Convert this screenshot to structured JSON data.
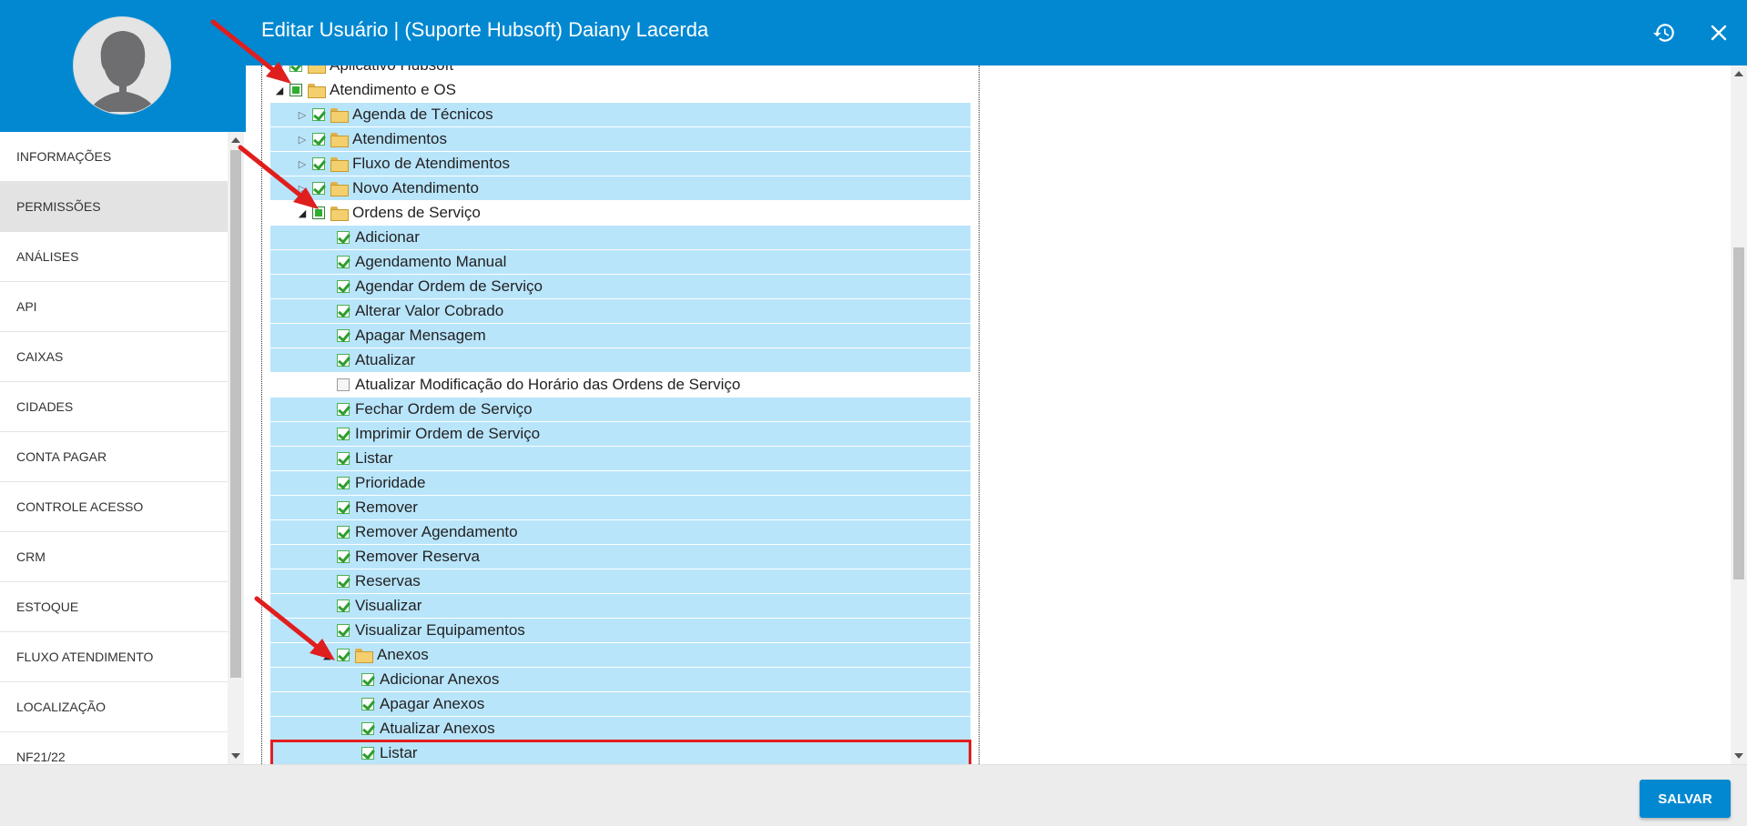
{
  "header": {
    "title": "Editar Usuário | (Suporte Hubsoft) Daiany Lacerda",
    "history_icon": "history-icon",
    "close_icon": "close-icon"
  },
  "sidebar": {
    "items": [
      {
        "label": "INFORMAÇÕES",
        "active": false
      },
      {
        "label": "PERMISSÕES",
        "active": true
      },
      {
        "label": "ANÁLISES",
        "active": false
      },
      {
        "label": "API",
        "active": false
      },
      {
        "label": "CAIXAS",
        "active": false
      },
      {
        "label": "CIDADES",
        "active": false
      },
      {
        "label": "CONTA PAGAR",
        "active": false
      },
      {
        "label": "CONTROLE ACESSO",
        "active": false
      },
      {
        "label": "CRM",
        "active": false
      },
      {
        "label": "ESTOQUE",
        "active": false
      },
      {
        "label": "FLUXO ATENDIMENTO",
        "active": false
      },
      {
        "label": "LOCALIZAÇÃO",
        "active": false
      },
      {
        "label": "NF21/22",
        "active": false
      }
    ]
  },
  "tree": {
    "rows": [
      {
        "label": "Aplicativo Hubsoft",
        "level": 1,
        "expander": "closed",
        "check": "checked",
        "folder": true,
        "selected": false
      },
      {
        "label": "Atendimento e OS",
        "level": 1,
        "expander": "open",
        "check": "partial",
        "folder": true,
        "selected": false
      },
      {
        "label": "Agenda de Técnicos",
        "level": 2,
        "expander": "closed",
        "check": "checked",
        "folder": true,
        "selected": true
      },
      {
        "label": "Atendimentos",
        "level": 2,
        "expander": "closed",
        "check": "checked",
        "folder": true,
        "selected": true
      },
      {
        "label": "Fluxo de Atendimentos",
        "level": 2,
        "expander": "closed",
        "check": "checked",
        "folder": true,
        "selected": true
      },
      {
        "label": "Novo Atendimento",
        "level": 2,
        "expander": "closed",
        "check": "checked",
        "folder": true,
        "selected": true
      },
      {
        "label": "Ordens de Serviço",
        "level": 2,
        "expander": "open",
        "check": "partial",
        "folder": true,
        "selected": false
      },
      {
        "label": "Adicionar",
        "level": 3,
        "expander": "none",
        "check": "checked",
        "folder": false,
        "selected": true
      },
      {
        "label": "Agendamento Manual",
        "level": 3,
        "expander": "none",
        "check": "checked",
        "folder": false,
        "selected": true
      },
      {
        "label": "Agendar Ordem de Serviço",
        "level": 3,
        "expander": "none",
        "check": "checked",
        "folder": false,
        "selected": true
      },
      {
        "label": "Alterar Valor Cobrado",
        "level": 3,
        "expander": "none",
        "check": "checked",
        "folder": false,
        "selected": true
      },
      {
        "label": "Apagar Mensagem",
        "level": 3,
        "expander": "none",
        "check": "checked",
        "folder": false,
        "selected": true
      },
      {
        "label": "Atualizar",
        "level": 3,
        "expander": "none",
        "check": "checked",
        "folder": false,
        "selected": true
      },
      {
        "label": "Atualizar Modificação do Horário das Ordens de Serviço",
        "level": 3,
        "expander": "none",
        "check": "unchecked",
        "folder": false,
        "selected": false
      },
      {
        "label": "Fechar Ordem de Serviço",
        "level": 3,
        "expander": "none",
        "check": "checked",
        "folder": false,
        "selected": true
      },
      {
        "label": "Imprimir Ordem de Serviço",
        "level": 3,
        "expander": "none",
        "check": "checked",
        "folder": false,
        "selected": true
      },
      {
        "label": "Listar",
        "level": 3,
        "expander": "none",
        "check": "checked",
        "folder": false,
        "selected": true
      },
      {
        "label": "Prioridade",
        "level": 3,
        "expander": "none",
        "check": "checked",
        "folder": false,
        "selected": true
      },
      {
        "label": "Remover",
        "level": 3,
        "expander": "none",
        "check": "checked",
        "folder": false,
        "selected": true
      },
      {
        "label": "Remover Agendamento",
        "level": 3,
        "expander": "none",
        "check": "checked",
        "folder": false,
        "selected": true
      },
      {
        "label": "Remover Reserva",
        "level": 3,
        "expander": "none",
        "check": "checked",
        "folder": false,
        "selected": true
      },
      {
        "label": "Reservas",
        "level": 3,
        "expander": "none",
        "check": "checked",
        "folder": false,
        "selected": true
      },
      {
        "label": "Visualizar",
        "level": 3,
        "expander": "none",
        "check": "checked",
        "folder": false,
        "selected": true
      },
      {
        "label": "Visualizar Equipamentos",
        "level": 3,
        "expander": "none",
        "check": "checked",
        "folder": false,
        "selected": true
      },
      {
        "label": "Anexos",
        "level": 3,
        "expander": "open",
        "check": "checked",
        "folder": true,
        "selected": true
      },
      {
        "label": "Adicionar Anexos",
        "level": 4,
        "expander": "none",
        "check": "checked",
        "folder": false,
        "selected": true
      },
      {
        "label": "Apagar Anexos",
        "level": 4,
        "expander": "none",
        "check": "checked",
        "folder": false,
        "selected": true
      },
      {
        "label": "Atualizar Anexos",
        "level": 4,
        "expander": "none",
        "check": "checked",
        "folder": false,
        "selected": true
      },
      {
        "label": "Listar",
        "level": 4,
        "expander": "none",
        "check": "checked",
        "folder": false,
        "selected": true,
        "highlighted": true
      }
    ]
  },
  "footer": {
    "save_label": "SALVAR"
  },
  "colors": {
    "primary": "#0288d1",
    "row_selected": "#b9e5fb",
    "highlight": "#e01e1e",
    "annotation_arrow": "#e01e1e"
  }
}
